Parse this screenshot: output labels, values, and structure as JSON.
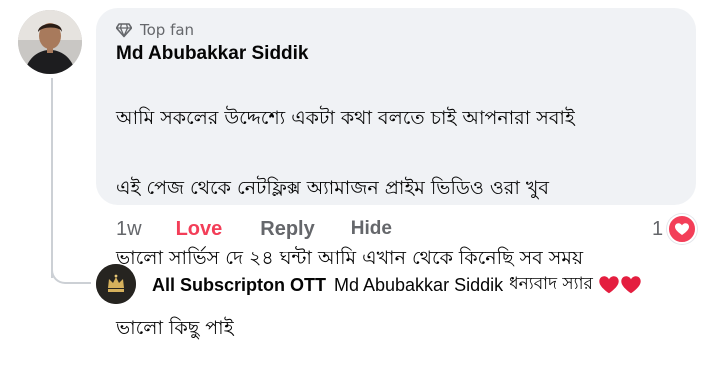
{
  "comment": {
    "badge": "Top fan",
    "author": "Md Abubakkar Siddik",
    "body_lines": [
      "আমি সকলের উদ্দেশ্যে একটা কথা বলতে চাই আপনারা সবাই",
      "এই পেজ থেকে নেটফ্লিক্স অ্যামাজন প্রাইম ভিডিও ওরা খুব",
      "ভালো সার্ভিস দে ২৪ ঘন্টা আমি এখান থেকে কিনেছি সব সময়",
      "ভালো কিছু পাই"
    ],
    "time": "1w",
    "love_label": "Love",
    "reply_label": "Reply",
    "hide_label": "Hide",
    "reaction_count": "1",
    "reaction_icon": "heart-reaction-icon"
  },
  "reply": {
    "author": "All Subscripton OTT",
    "mention": "Md Abubakkar Siddik",
    "text": "ধন্যবাদ স্যার",
    "emoji": "❤️❤️"
  },
  "colors": {
    "bubble": "#f0f2f5",
    "love": "#f33e58",
    "muted": "#65676b",
    "heart": "#e41e3f"
  }
}
